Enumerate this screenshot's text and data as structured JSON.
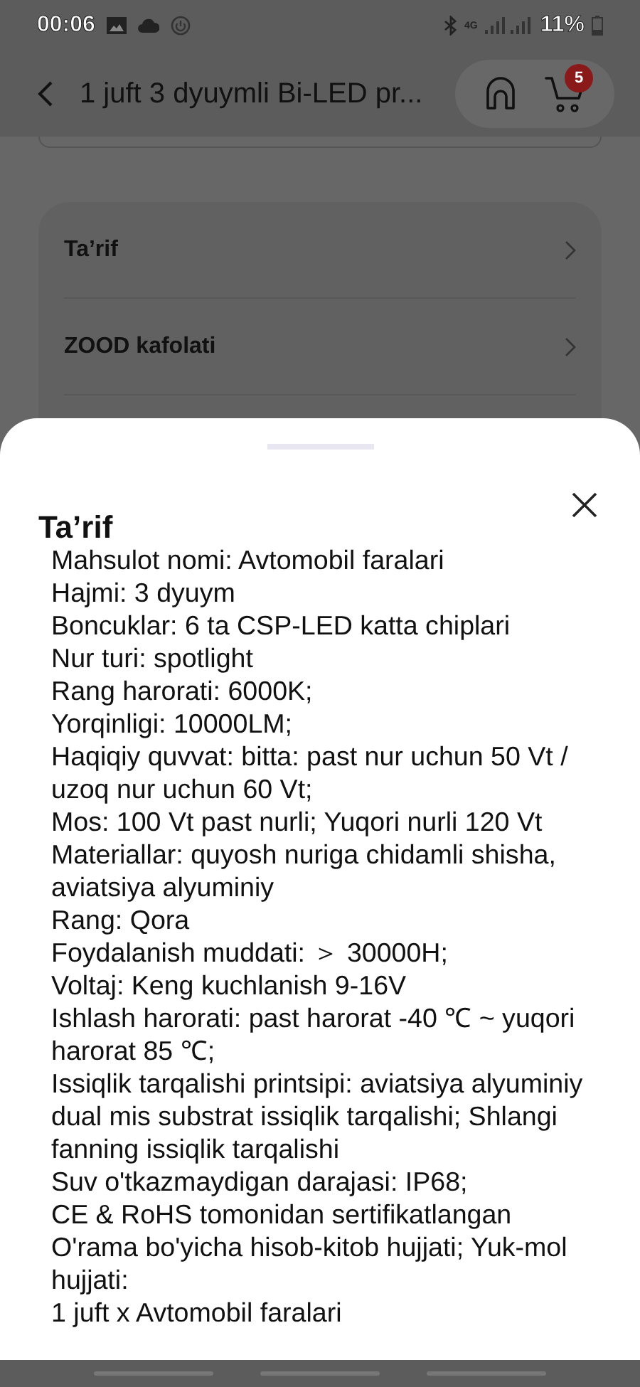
{
  "status_bar": {
    "time": "00:06",
    "network": "4G",
    "battery": "11%"
  },
  "header": {
    "title": "1 juft 3 dyuymli Bi-LED pr...",
    "cart_count": "5"
  },
  "details_menu": {
    "items": [
      {
        "label": "Ta’rif"
      },
      {
        "label": "ZOOD kafolati"
      }
    ]
  },
  "sheet": {
    "title": "Ta’rif",
    "lines": [
      "Mahsulot nomi: Avtomobil faralari",
      "Hajmi: 3 dyuym",
      "Boncuklar: 6 ta CSP-LED katta chiplari",
      "Nur turi: spotlight",
      "Rang harorati: 6000K;",
      "Yorqinligi: 10000LM;",
      "Haqiqiy quvvat: bitta: past nur uchun 50 Vt / uzoq nur uchun 60 Vt;",
      "Mos: 100 Vt past nurli; Yuqori nurli 120 Vt",
      "Materiallar: quyosh nuriga chidamli shisha, aviatsiya alyuminiy",
      "Rang: Qora",
      "Foydalanish muddati: ＞ 30000H;",
      "Voltaj: Keng kuchlanish 9-16V",
      "Ishlash harorati: past harorat -40 ℃ ~ yuqori harorat 85 ℃;",
      "Issiqlik tarqalishi printsipi: aviatsiya alyuminiy dual mis substrat issiqlik tarqalishi; Shlangi fanning issiqlik tarqalishi",
      "Suv o'tkazmaydigan darajasi: IP68;",
      "CE & RoHS tomonidan sertifikatlangan",
      "O'rama bo'yicha hisob-kitob hujjati; Yuk-mol hujjati:",
      "1 juft x Avtomobil faralari"
    ]
  }
}
